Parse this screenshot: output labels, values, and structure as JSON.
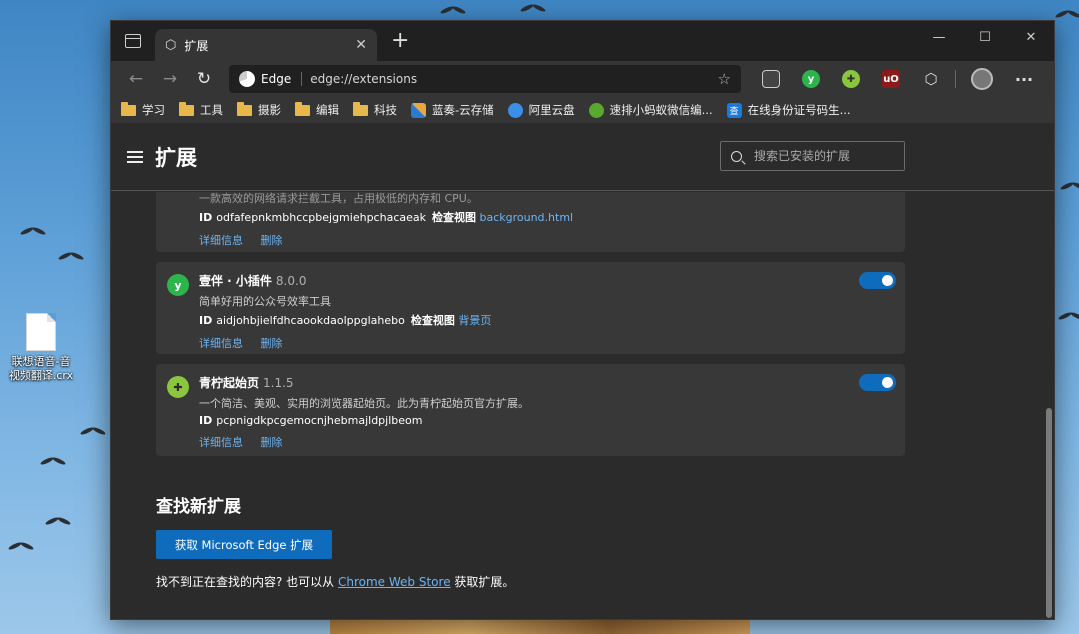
{
  "desktop": {
    "file_label_line1": "联想语音-音",
    "file_label_line2": "视频翻译.crx"
  },
  "browser": {
    "tab_title": "扩展",
    "tab_close": "✕",
    "new_tab": "+",
    "window_controls": {
      "minimize": "—",
      "maximize": "☐",
      "close": "✕"
    },
    "nav": {
      "back": "←",
      "forward": "→",
      "refresh": "↻"
    },
    "address": {
      "brand": "Edge",
      "url": "edge://extensions"
    },
    "toolbar_icons": {
      "green_y": "y",
      "ublock": "uO",
      "more": "···"
    },
    "bookmarks": [
      {
        "label": "学习",
        "icon": "folder-icon"
      },
      {
        "label": "工具",
        "icon": "folder-icon"
      },
      {
        "label": "摄影",
        "icon": "folder-icon"
      },
      {
        "label": "编辑",
        "icon": "folder-icon"
      },
      {
        "label": "科技",
        "icon": "folder-icon"
      },
      {
        "label": "蓝奏-云存储",
        "icon": "chart-icon"
      },
      {
        "label": "阿里云盘",
        "icon": "cloud-icon"
      },
      {
        "label": "速排小蚂蚁微信编...",
        "icon": "ant-icon"
      },
      {
        "label": "在线身份证号码生...",
        "icon": "cha-icon",
        "glyph": "查"
      }
    ]
  },
  "page": {
    "title": "扩展",
    "search_placeholder": "搜索已安装的扩展",
    "extensions": [
      {
        "name": "",
        "version": "",
        "description": "一款高效的网络请求拦截工具，占用极低的内存和 CPU。",
        "id_label": "ID",
        "id": "odfafepnkmbhccpbejgmiehpchacaeak",
        "inspect_label": "检查视图",
        "inspect_link": "background.html",
        "details": "详细信息",
        "remove": "删除"
      },
      {
        "name": "壹伴 · 小插件",
        "version": "8.0.0",
        "description": "简单好用的公众号效率工具",
        "id_label": "ID",
        "id": "aidjohbjielfdhcaookdaolppglahebo",
        "inspect_label": "检查视图",
        "inspect_link": "背景页",
        "details": "详细信息",
        "remove": "删除",
        "enabled": true,
        "icon_glyph": "y"
      },
      {
        "name": "青柠起始页",
        "version": "1.1.5",
        "description": "一个简洁、美观、实用的浏览器起始页。此为青柠起始页官方扩展。",
        "id_label": "ID",
        "id": "pcpnigdkpcgemocnjhebmajldpjlbeom",
        "details": "详细信息",
        "remove": "删除",
        "enabled": true
      }
    ],
    "find_section": {
      "title": "查找新扩展",
      "button": "获取 Microsoft Edge 扩展",
      "text_before": "找不到正在查找的内容? 也可以从 ",
      "link": "Chrome Web Store",
      "text_after": " 获取扩展。"
    }
  },
  "colors": {
    "accent": "#0f6cbd",
    "link": "#6cb4f3",
    "page_bg": "#2b2b2b",
    "card_bg": "#383838"
  }
}
